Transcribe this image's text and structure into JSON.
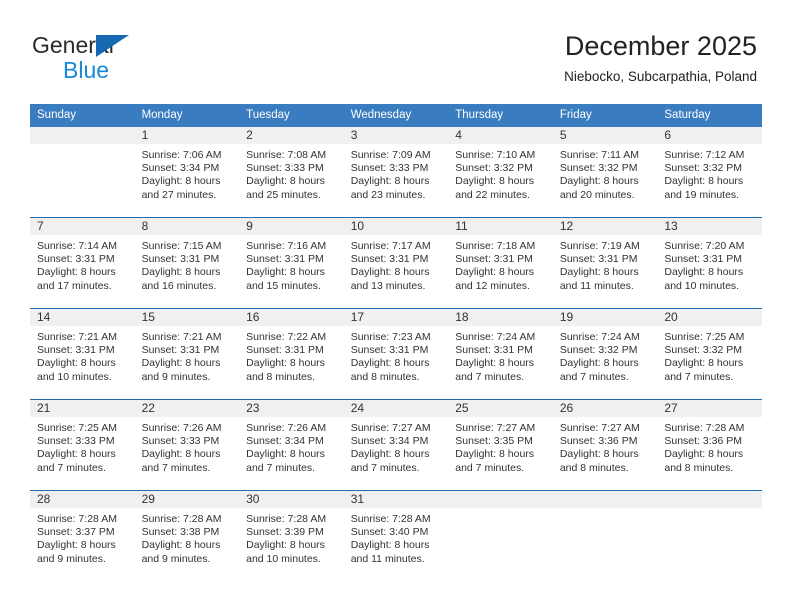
{
  "brand": {
    "name_part1": "General",
    "name_part2": "Blue",
    "triangle_color": "#1668b3",
    "blue_color": "#1887d6"
  },
  "header": {
    "title": "December 2025",
    "location": "Niebocko, Subcarpathia, Poland"
  },
  "colors": {
    "header_row": "#3a7cc0",
    "week_divider": "#1f6cb0",
    "daynum_band": "#f0f0f0"
  },
  "weekday_headers": [
    "Sunday",
    "Monday",
    "Tuesday",
    "Wednesday",
    "Thursday",
    "Friday",
    "Saturday"
  ],
  "weeks": [
    [
      {
        "day": "",
        "l1": "",
        "l2": "",
        "l3": "",
        "l4": ""
      },
      {
        "day": "1",
        "l1": "Sunrise: 7:06 AM",
        "l2": "Sunset: 3:34 PM",
        "l3": "Daylight: 8 hours",
        "l4": "and 27 minutes."
      },
      {
        "day": "2",
        "l1": "Sunrise: 7:08 AM",
        "l2": "Sunset: 3:33 PM",
        "l3": "Daylight: 8 hours",
        "l4": "and 25 minutes."
      },
      {
        "day": "3",
        "l1": "Sunrise: 7:09 AM",
        "l2": "Sunset: 3:33 PM",
        "l3": "Daylight: 8 hours",
        "l4": "and 23 minutes."
      },
      {
        "day": "4",
        "l1": "Sunrise: 7:10 AM",
        "l2": "Sunset: 3:32 PM",
        "l3": "Daylight: 8 hours",
        "l4": "and 22 minutes."
      },
      {
        "day": "5",
        "l1": "Sunrise: 7:11 AM",
        "l2": "Sunset: 3:32 PM",
        "l3": "Daylight: 8 hours",
        "l4": "and 20 minutes."
      },
      {
        "day": "6",
        "l1": "Sunrise: 7:12 AM",
        "l2": "Sunset: 3:32 PM",
        "l3": "Daylight: 8 hours",
        "l4": "and 19 minutes."
      }
    ],
    [
      {
        "day": "7",
        "l1": "Sunrise: 7:14 AM",
        "l2": "Sunset: 3:31 PM",
        "l3": "Daylight: 8 hours",
        "l4": "and 17 minutes."
      },
      {
        "day": "8",
        "l1": "Sunrise: 7:15 AM",
        "l2": "Sunset: 3:31 PM",
        "l3": "Daylight: 8 hours",
        "l4": "and 16 minutes."
      },
      {
        "day": "9",
        "l1": "Sunrise: 7:16 AM",
        "l2": "Sunset: 3:31 PM",
        "l3": "Daylight: 8 hours",
        "l4": "and 15 minutes."
      },
      {
        "day": "10",
        "l1": "Sunrise: 7:17 AM",
        "l2": "Sunset: 3:31 PM",
        "l3": "Daylight: 8 hours",
        "l4": "and 13 minutes."
      },
      {
        "day": "11",
        "l1": "Sunrise: 7:18 AM",
        "l2": "Sunset: 3:31 PM",
        "l3": "Daylight: 8 hours",
        "l4": "and 12 minutes."
      },
      {
        "day": "12",
        "l1": "Sunrise: 7:19 AM",
        "l2": "Sunset: 3:31 PM",
        "l3": "Daylight: 8 hours",
        "l4": "and 11 minutes."
      },
      {
        "day": "13",
        "l1": "Sunrise: 7:20 AM",
        "l2": "Sunset: 3:31 PM",
        "l3": "Daylight: 8 hours",
        "l4": "and 10 minutes."
      }
    ],
    [
      {
        "day": "14",
        "l1": "Sunrise: 7:21 AM",
        "l2": "Sunset: 3:31 PM",
        "l3": "Daylight: 8 hours",
        "l4": "and 10 minutes."
      },
      {
        "day": "15",
        "l1": "Sunrise: 7:21 AM",
        "l2": "Sunset: 3:31 PM",
        "l3": "Daylight: 8 hours",
        "l4": "and 9 minutes."
      },
      {
        "day": "16",
        "l1": "Sunrise: 7:22 AM",
        "l2": "Sunset: 3:31 PM",
        "l3": "Daylight: 8 hours",
        "l4": "and 8 minutes."
      },
      {
        "day": "17",
        "l1": "Sunrise: 7:23 AM",
        "l2": "Sunset: 3:31 PM",
        "l3": "Daylight: 8 hours",
        "l4": "and 8 minutes."
      },
      {
        "day": "18",
        "l1": "Sunrise: 7:24 AM",
        "l2": "Sunset: 3:31 PM",
        "l3": "Daylight: 8 hours",
        "l4": "and 7 minutes."
      },
      {
        "day": "19",
        "l1": "Sunrise: 7:24 AM",
        "l2": "Sunset: 3:32 PM",
        "l3": "Daylight: 8 hours",
        "l4": "and 7 minutes."
      },
      {
        "day": "20",
        "l1": "Sunrise: 7:25 AM",
        "l2": "Sunset: 3:32 PM",
        "l3": "Daylight: 8 hours",
        "l4": "and 7 minutes."
      }
    ],
    [
      {
        "day": "21",
        "l1": "Sunrise: 7:25 AM",
        "l2": "Sunset: 3:33 PM",
        "l3": "Daylight: 8 hours",
        "l4": "and 7 minutes."
      },
      {
        "day": "22",
        "l1": "Sunrise: 7:26 AM",
        "l2": "Sunset: 3:33 PM",
        "l3": "Daylight: 8 hours",
        "l4": "and 7 minutes."
      },
      {
        "day": "23",
        "l1": "Sunrise: 7:26 AM",
        "l2": "Sunset: 3:34 PM",
        "l3": "Daylight: 8 hours",
        "l4": "and 7 minutes."
      },
      {
        "day": "24",
        "l1": "Sunrise: 7:27 AM",
        "l2": "Sunset: 3:34 PM",
        "l3": "Daylight: 8 hours",
        "l4": "and 7 minutes."
      },
      {
        "day": "25",
        "l1": "Sunrise: 7:27 AM",
        "l2": "Sunset: 3:35 PM",
        "l3": "Daylight: 8 hours",
        "l4": "and 7 minutes."
      },
      {
        "day": "26",
        "l1": "Sunrise: 7:27 AM",
        "l2": "Sunset: 3:36 PM",
        "l3": "Daylight: 8 hours",
        "l4": "and 8 minutes."
      },
      {
        "day": "27",
        "l1": "Sunrise: 7:28 AM",
        "l2": "Sunset: 3:36 PM",
        "l3": "Daylight: 8 hours",
        "l4": "and 8 minutes."
      }
    ],
    [
      {
        "day": "28",
        "l1": "Sunrise: 7:28 AM",
        "l2": "Sunset: 3:37 PM",
        "l3": "Daylight: 8 hours",
        "l4": "and 9 minutes."
      },
      {
        "day": "29",
        "l1": "Sunrise: 7:28 AM",
        "l2": "Sunset: 3:38 PM",
        "l3": "Daylight: 8 hours",
        "l4": "and 9 minutes."
      },
      {
        "day": "30",
        "l1": "Sunrise: 7:28 AM",
        "l2": "Sunset: 3:39 PM",
        "l3": "Daylight: 8 hours",
        "l4": "and 10 minutes."
      },
      {
        "day": "31",
        "l1": "Sunrise: 7:28 AM",
        "l2": "Sunset: 3:40 PM",
        "l3": "Daylight: 8 hours",
        "l4": "and 11 minutes."
      },
      {
        "day": "",
        "l1": "",
        "l2": "",
        "l3": "",
        "l4": ""
      },
      {
        "day": "",
        "l1": "",
        "l2": "",
        "l3": "",
        "l4": ""
      },
      {
        "day": "",
        "l1": "",
        "l2": "",
        "l3": "",
        "l4": ""
      }
    ]
  ]
}
